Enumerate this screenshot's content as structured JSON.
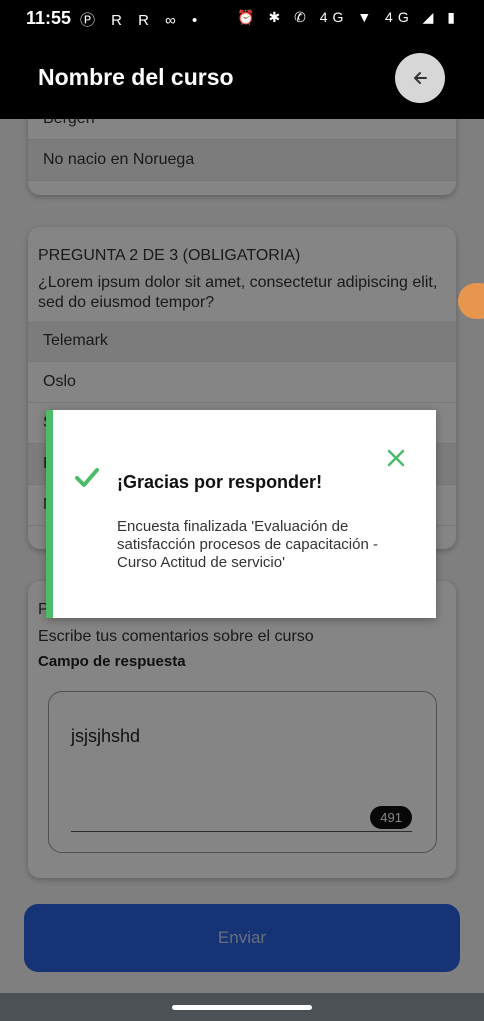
{
  "status_bar": {
    "time": "11:55",
    "left_icons": "Ⓟ R R ∞ •",
    "right_icons": "⏰ ✱ ✆ 4G ▼ 4G ◢ ▮"
  },
  "header": {
    "title": "Nombre del curso",
    "back_icon": "arrow-left-icon"
  },
  "question1": {
    "partial_option": "Bergen",
    "options": [
      "No nacio en Noruega"
    ]
  },
  "question2": {
    "label": "PREGUNTA 2 DE 3  (OBLIGATORIA)",
    "text": "¿Lorem ipsum dolor sit amet, consectetur adipiscing elit, sed do eiusmod tempor?",
    "options": [
      "Telemark",
      "Oslo",
      "S",
      "B",
      "N"
    ]
  },
  "question3": {
    "label": "P",
    "text": "Escribe tus comentarios sobre el curso",
    "field_label": "Campo de respuesta",
    "value": "jsjsjhshd",
    "counter": "491"
  },
  "submit_label": "Enviar",
  "toast": {
    "title": "¡Gracias por responder!",
    "message": "Encuesta finalizada 'Evaluación de satisfacción procesos de capacitación - Curso Actitud de servicio'",
    "accent_color": "#4cbc6a",
    "icons": [
      "checkmark-icon",
      "close-icon"
    ]
  }
}
